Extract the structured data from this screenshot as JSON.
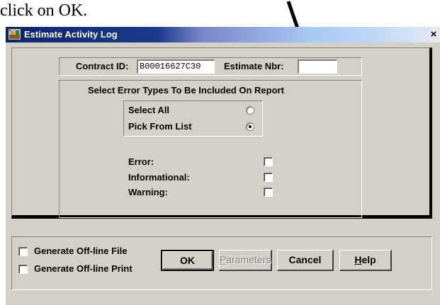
{
  "caption": "click on OK.",
  "window": {
    "title": "Estimate Activity Log",
    "close_glyph": "×"
  },
  "contract": {
    "contract_id_label": "Contract ID:",
    "contract_id_value": "B00016627C30",
    "estimate_nbr_label": "Estimate Nbr:",
    "estimate_nbr_value": ""
  },
  "error_types": {
    "heading": "Select Error Types To Be Included On Report",
    "select_all_label": "Select All",
    "pick_from_list_label": "Pick From List",
    "selected_mode": "pick_from_list",
    "error_label": "Error:",
    "informational_label": "Informational:",
    "warning_label": "Warning:"
  },
  "options": {
    "offline_file_label": "Generate Off-line File",
    "offline_print_label": "Generate Off-line Print"
  },
  "buttons": {
    "ok": "OK",
    "parameters_accel": "P",
    "parameters_rest": "arameters",
    "cancel": "Cancel",
    "help_accel": "H",
    "help_rest": "elp"
  },
  "icons": {
    "title_icon": "app-icon",
    "arrow": "down-arrow-annotation"
  }
}
